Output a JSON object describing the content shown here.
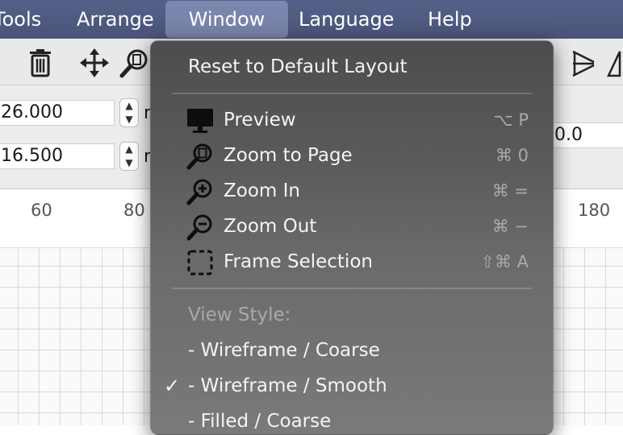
{
  "menubar": {
    "items": [
      "Tools",
      "Arrange",
      "Window",
      "Language",
      "Help"
    ],
    "active": "Window"
  },
  "fields": {
    "field1_value": "26.000",
    "field2_value": "16.500",
    "field3_value": "0.0",
    "unit1": "r",
    "unit2": "r"
  },
  "ruler": {
    "labels": [
      "60",
      "80",
      "180"
    ]
  },
  "menu": {
    "reset_label": "Reset to Default Layout",
    "items": [
      {
        "label": "Preview",
        "shortcut": "⌥ P",
        "icon": "monitor-icon"
      },
      {
        "label": "Zoom to Page",
        "shortcut": "⌘ 0",
        "icon": "zoom-page-icon"
      },
      {
        "label": "Zoom In",
        "shortcut": "⌘ =",
        "icon": "zoom-in-icon"
      },
      {
        "label": "Zoom Out",
        "shortcut": "⌘ −",
        "icon": "zoom-out-icon"
      },
      {
        "label": "Frame Selection",
        "shortcut": "⇧⌘ A",
        "icon": "frame-selection-icon"
      }
    ],
    "view_style_header": "View Style:",
    "view_styles": [
      {
        "label": "-  Wireframe / Coarse",
        "checked": false
      },
      {
        "label": "-  Wireframe / Smooth",
        "checked": true
      },
      {
        "label": "-  Filled / Coarse",
        "checked": false
      }
    ],
    "check_mark": "✓"
  },
  "colors": {
    "menubar": "#4f5a7e",
    "menu_background": "#5a5a5b",
    "menu_text": "#f4f4f4",
    "menu_muted": "#a9a9a9"
  }
}
